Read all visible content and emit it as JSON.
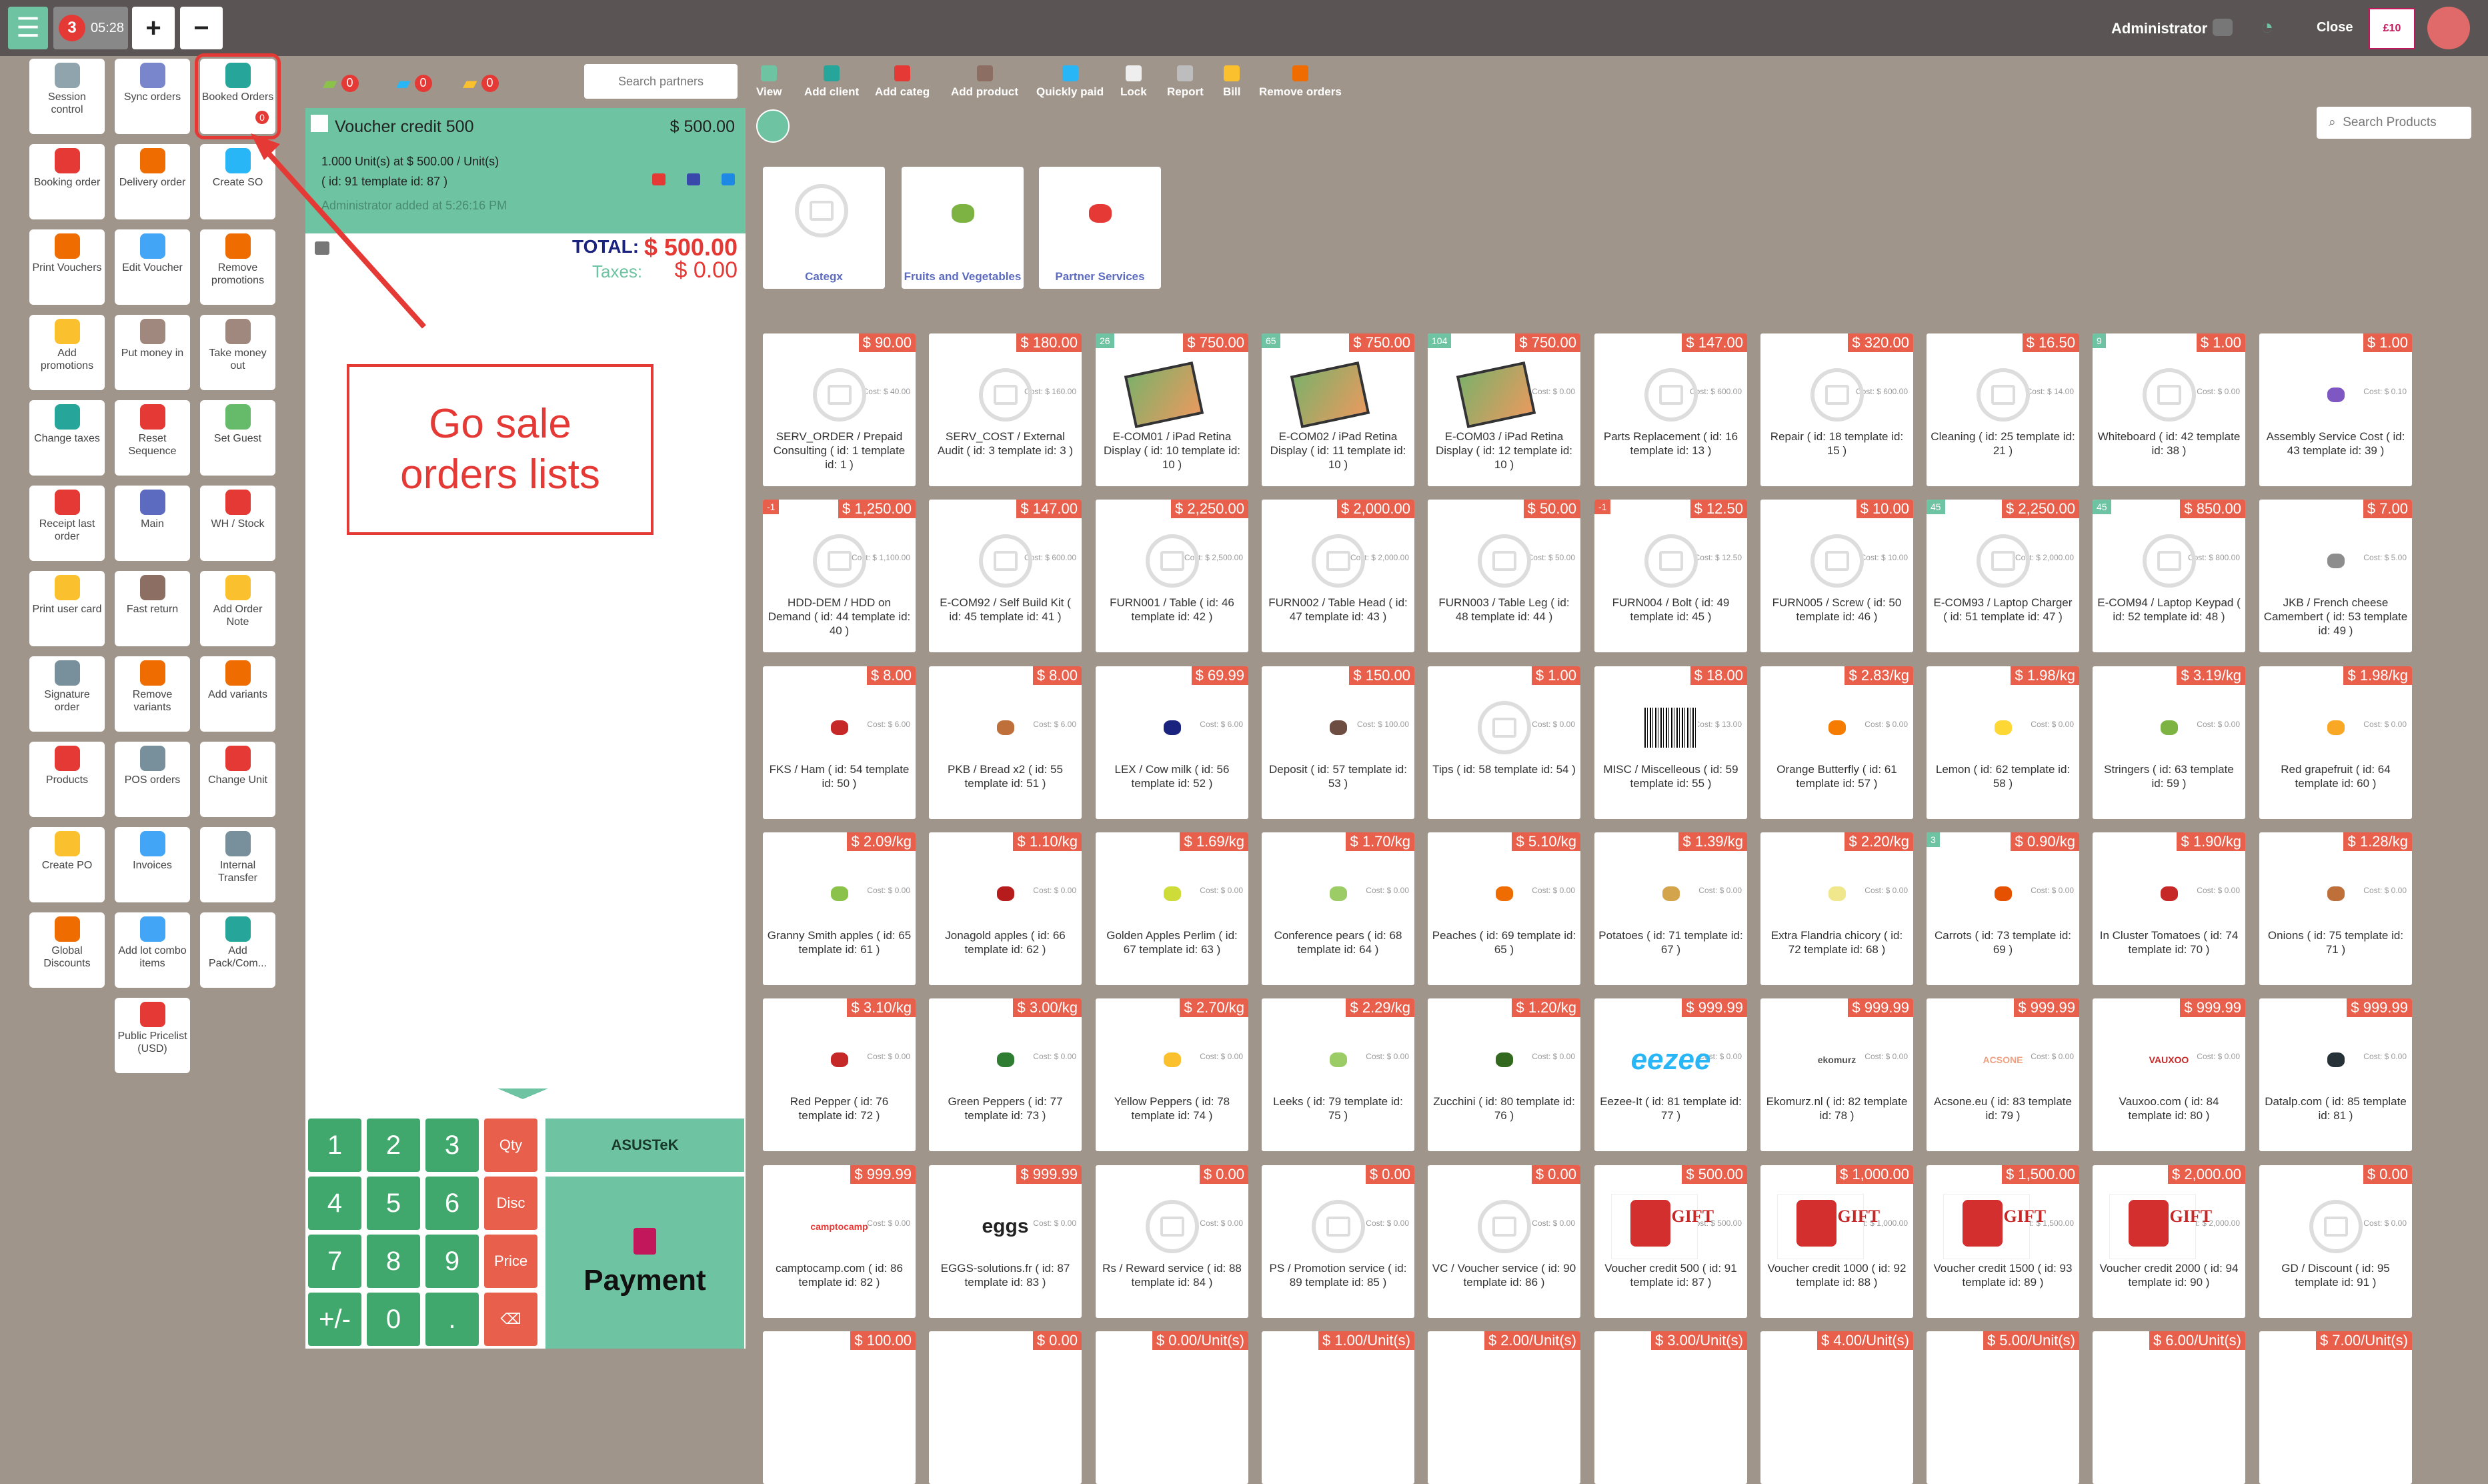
{
  "topbar": {
    "orders_count": "3",
    "time": "05:28",
    "plus": "+",
    "minus": "−",
    "user": "Administrator",
    "close": "Close",
    "gift_label": "£10"
  },
  "actions": [
    {
      "label": "Session control",
      "icon": "session-icon",
      "color": "#90a4ae"
    },
    {
      "label": "Sync orders",
      "icon": "sync-icon",
      "color": "#7986cb"
    },
    {
      "label": "Booked Orders",
      "icon": "booked-orders-icon",
      "color": "#26a69a",
      "badge": "0"
    },
    {
      "label": "Booking order",
      "icon": "booking-icon",
      "color": "#e53935"
    },
    {
      "label": "Delivery order",
      "icon": "delivery-icon",
      "color": "#ef6c00"
    },
    {
      "label": "Create SO",
      "icon": "create-so-icon",
      "color": "#29b6f6"
    },
    {
      "label": "Print Vouchers",
      "icon": "print-voucher-icon",
      "color": "#ef6c00"
    },
    {
      "label": "Edit Voucher",
      "icon": "edit-voucher-icon",
      "color": "#42a5f5"
    },
    {
      "label": "Remove promotions",
      "icon": "remove-promo-icon",
      "color": "#ef6c00"
    },
    {
      "label": "Add promotions",
      "icon": "add-promo-icon",
      "color": "#fbc02d"
    },
    {
      "label": "Put money in",
      "icon": "money-in-icon",
      "color": "#a1887f"
    },
    {
      "label": "Take money out",
      "icon": "money-out-icon",
      "color": "#a1887f"
    },
    {
      "label": "Change taxes",
      "icon": "taxes-icon",
      "color": "#26a69a"
    },
    {
      "label": "Reset Sequence",
      "icon": "reset-icon",
      "color": "#e53935"
    },
    {
      "label": "Set Guest",
      "icon": "guest-icon",
      "color": "#66bb6a"
    },
    {
      "label": "Receipt last order",
      "icon": "receipt-icon",
      "color": "#e53935"
    },
    {
      "label": "Main",
      "icon": "main-icon",
      "color": "#5c6bc0"
    },
    {
      "label": "WH / Stock",
      "icon": "stock-icon",
      "color": "#e53935"
    },
    {
      "label": "Print user card",
      "icon": "user-card-icon",
      "color": "#fbc02d"
    },
    {
      "label": "Fast return",
      "icon": "fast-return-icon",
      "color": "#8d6e63"
    },
    {
      "label": "Add Order Note",
      "icon": "note-icon",
      "color": "#fbc02d"
    },
    {
      "label": "Signature order",
      "icon": "signature-icon",
      "color": "#78909c"
    },
    {
      "label": "Remove variants",
      "icon": "remove-variants-icon",
      "color": "#ef6c00"
    },
    {
      "label": "Add variants",
      "icon": "add-variants-icon",
      "color": "#ef6c00"
    },
    {
      "label": "Products",
      "icon": "products-icon",
      "color": "#e53935"
    },
    {
      "label": "POS orders",
      "icon": "pos-orders-icon",
      "color": "#78909c"
    },
    {
      "label": "Change Unit",
      "icon": "change-unit-icon",
      "color": "#e53935"
    },
    {
      "label": "Create PO",
      "icon": "create-po-icon",
      "color": "#fbc02d"
    },
    {
      "label": "Invoices",
      "icon": "invoices-icon",
      "color": "#42a5f5"
    },
    {
      "label": "Internal Transfer",
      "icon": "transfer-icon",
      "color": "#78909c"
    },
    {
      "label": "Global Discounts",
      "icon": "discounts-icon",
      "color": "#ef6c00"
    },
    {
      "label": "Add lot combo items",
      "icon": "lot-icon",
      "color": "#42a5f5"
    },
    {
      "label": "Add Pack/Com...",
      "icon": "pack-icon",
      "color": "#26a69a"
    },
    {
      "label": "Public Pricelist (USD)",
      "icon": "pricelist-icon",
      "color": "#e53935"
    }
  ],
  "order": {
    "chips": [
      "0",
      "0",
      "0"
    ],
    "search_placeholder": "Search partners",
    "line_name": "Voucher credit 500",
    "line_price": "$ 500.00",
    "line_qty": "1.000 Unit(s) at $ 500.00 / Unit(s)",
    "line_id": "( id: 91 template id: 87 )",
    "line_added": "Administrator added at 5:26:16 PM",
    "total_label": "TOTAL:",
    "total_value": "$ 500.00",
    "taxes_label": "Taxes:",
    "taxes_value": "$ 0.00"
  },
  "keypad": [
    "1",
    "2",
    "3",
    "Qty",
    "4",
    "5",
    "6",
    "Disc",
    "7",
    "8",
    "9",
    "Price",
    "+/-",
    "0",
    ".",
    "⌫"
  ],
  "customer": "ASUSTeK",
  "payment": "Payment",
  "toolbar": [
    {
      "label": "View",
      "color": "#6ec3a2"
    },
    {
      "label": "Add client",
      "color": "#26a69a"
    },
    {
      "label": "Add categ",
      "color": "#e53935"
    },
    {
      "label": "Add product",
      "color": "#8d6e63"
    },
    {
      "label": "Quickly paid",
      "color": "#29b6f6"
    },
    {
      "label": "Lock",
      "color": "#eeeeee"
    },
    {
      "label": "Report",
      "color": "#bdbdbd"
    },
    {
      "label": "Bill",
      "color": "#fbc02d"
    },
    {
      "label": "Remove orders",
      "color": "#ef6c00"
    }
  ],
  "search_products": "Search Products",
  "categories": [
    "Categx",
    "Fruits and Vegetables",
    "Partner Services"
  ],
  "products": [
    {
      "price": "$ 90.00",
      "cost": "Cost: $ 40.00",
      "name": "SERV_ORDER / Prepaid Consulting ( id: 1 template id: 1 )",
      "img": "ph"
    },
    {
      "price": "$ 180.00",
      "cost": "Cost: $ 160.00",
      "name": "SERV_COST / External Audit ( id: 3 template id: 3 )",
      "img": "ph"
    },
    {
      "price": "$ 750.00",
      "stock": "26",
      "name": "E-COM01 / iPad Retina Display ( id: 10 template id: 10 )",
      "img": "ipad"
    },
    {
      "price": "$ 750.00",
      "stock": "65",
      "name": "E-COM02 / iPad Retina Display ( id: 11 template id: 10 )",
      "img": "ipad"
    },
    {
      "price": "$ 750.00",
      "stock": "104",
      "cost": "Cost: $ 0.00",
      "name": "E-COM03 / iPad Retina Display ( id: 12 template id: 10 )",
      "img": "ipad"
    },
    {
      "price": "$ 147.00",
      "cost": "Cost: $ 600.00",
      "name": "Parts Replacement ( id: 16 template id: 13 )",
      "img": "ph"
    },
    {
      "price": "$ 320.00",
      "cost": "Cost: $ 600.00",
      "name": "Repair ( id: 18 template id: 15 )",
      "img": "ph"
    },
    {
      "price": "$ 16.50",
      "cost": "Cost: $ 14.00",
      "name": "Cleaning ( id: 25 template id: 21 )",
      "img": "ph"
    },
    {
      "price": "$ 1.00",
      "stock": "9",
      "cost": "Cost: $ 0.00",
      "name": "Whiteboard ( id: 42 template id: 38 )",
      "img": "ph"
    },
    {
      "price": "$ 1.00",
      "cost": "Cost: $ 0.10",
      "name": "Assembly Service Cost ( id: 43 template id: 39 )",
      "img": "sw",
      "sw": "#7e57c2"
    },
    {
      "price": "$ 1,250.00",
      "stock": "-1",
      "neg": true,
      "cost": "Cost: $ 1,100.00",
      "name": "HDD-DEM / HDD on Demand ( id: 44 template id: 40 )",
      "img": "ph"
    },
    {
      "price": "$ 147.00",
      "cost": "Cost: $ 600.00",
      "name": "E-COM92 / Self Build Kit ( id: 45 template id: 41 )",
      "img": "ph"
    },
    {
      "price": "$ 2,250.00",
      "cost": "Cost: $ 2,500.00",
      "name": "FURN001 / Table ( id: 46 template id: 42 )",
      "img": "ph"
    },
    {
      "price": "$ 2,000.00",
      "cost": "Cost: $ 2,000.00",
      "name": "FURN002 / Table Head ( id: 47 template id: 43 )",
      "img": "ph"
    },
    {
      "price": "$ 50.00",
      "cost": "Cost: $ 50.00",
      "name": "FURN003 / Table Leg ( id: 48 template id: 44 )",
      "img": "ph"
    },
    {
      "price": "$ 12.50",
      "stock": "-1",
      "neg": true,
      "cost": "Cost: $ 12.50",
      "name": "FURN004 / Bolt ( id: 49 template id: 45 )",
      "img": "ph"
    },
    {
      "price": "$ 10.00",
      "cost": "Cost: $ 10.00",
      "name": "FURN005 / Screw ( id: 50 template id: 46 )",
      "img": "ph"
    },
    {
      "price": "$ 2,250.00",
      "stock": "45",
      "cost": "Cost: $ 2,000.00",
      "name": "E-COM93 / Laptop Charger ( id: 51 template id: 47 )",
      "img": "ph"
    },
    {
      "price": "$ 850.00",
      "stock": "45",
      "cost": "Cost: $ 800.00",
      "name": "E-COM94 / Laptop Keypad ( id: 52 template id: 48 )",
      "img": "ph"
    },
    {
      "price": "$ 7.00",
      "cost": "Cost: $ 5.00",
      "name": "JKB / French cheese Camembert ( id: 53 template id: 49 )",
      "img": "sw",
      "sw": "#8d8d8d"
    },
    {
      "price": "$ 8.00",
      "cost": "Cost: $ 6.00",
      "name": "FKS / Ham ( id: 54 template id: 50 )",
      "img": "sw",
      "sw": "#c62828"
    },
    {
      "price": "$ 8.00",
      "cost": "Cost: $ 6.00",
      "name": "PKB / Bread x2 ( id: 55 template id: 51 )",
      "img": "sw",
      "sw": "#bf6f3a"
    },
    {
      "price": "$ 69.99",
      "cost": "Cost: $ 6.00",
      "name": "LEX / Cow milk ( id: 56 template id: 52 )",
      "img": "sw",
      "sw": "#1a237e"
    },
    {
      "price": "$ 150.00",
      "cost": "Cost: $ 100.00",
      "name": "Deposit ( id: 57 template id: 53 )",
      "img": "sw",
      "sw": "#6d4c41"
    },
    {
      "price": "$ 1.00",
      "cost": "Cost: $ 0.00",
      "name": "Tips ( id: 58 template id: 54 )",
      "img": "ph"
    },
    {
      "price": "$ 18.00",
      "cost": "Cost: $ 13.00",
      "name": "MISC / Miscelleous ( id: 59 template id: 55 )",
      "img": "barcode"
    },
    {
      "price": "$ 2.83/kg",
      "cost": "Cost: $ 0.00",
      "name": "Orange Butterfly ( id: 61 template id: 57 )",
      "img": "sw",
      "sw": "#f57c00"
    },
    {
      "price": "$ 1.98/kg",
      "cost": "Cost: $ 0.00",
      "name": "Lemon ( id: 62 template id: 58 )",
      "img": "sw",
      "sw": "#fdd835"
    },
    {
      "price": "$ 3.19/kg",
      "cost": "Cost: $ 0.00",
      "name": "Stringers ( id: 63 template id: 59 )",
      "img": "sw",
      "sw": "#7cb342"
    },
    {
      "price": "$ 1.98/kg",
      "cost": "Cost: $ 0.00",
      "name": "Red grapefruit ( id: 64 template id: 60 )",
      "img": "sw",
      "sw": "#f9a825"
    },
    {
      "price": "$ 2.09/kg",
      "cost": "Cost: $ 0.00",
      "name": "Granny Smith apples ( id: 65 template id: 61 )",
      "img": "sw",
      "sw": "#8bc34a"
    },
    {
      "price": "$ 1.10/kg",
      "cost": "Cost: $ 0.00",
      "name": "Jonagold apples ( id: 66 template id: 62 )",
      "img": "sw",
      "sw": "#b71c1c"
    },
    {
      "price": "$ 1.69/kg",
      "cost": "Cost: $ 0.00",
      "name": "Golden Apples Perlim ( id: 67 template id: 63 )",
      "img": "sw",
      "sw": "#cddc39"
    },
    {
      "price": "$ 1.70/kg",
      "cost": "Cost: $ 0.00",
      "name": "Conference pears ( id: 68 template id: 64 )",
      "img": "sw",
      "sw": "#9ccc65"
    },
    {
      "price": "$ 5.10/kg",
      "cost": "Cost: $ 0.00",
      "name": "Peaches ( id: 69 template id: 65 )",
      "img": "sw",
      "sw": "#ef6c00"
    },
    {
      "price": "$ 1.39/kg",
      "cost": "Cost: $ 0.00",
      "name": "Potatoes ( id: 71 template id: 67 )",
      "img": "sw",
      "sw": "#d4a44c"
    },
    {
      "price": "$ 2.20/kg",
      "cost": "Cost: $ 0.00",
      "name": "Extra Flandria chicory ( id: 72 template id: 68 )",
      "img": "sw",
      "sw": "#f0e68c"
    },
    {
      "price": "$ 0.90/kg",
      "stock": "3",
      "cost": "Cost: $ 0.00",
      "name": "Carrots ( id: 73 template id: 69 )",
      "img": "sw",
      "sw": "#e65100"
    },
    {
      "price": "$ 1.90/kg",
      "cost": "Cost: $ 0.00",
      "name": "In Cluster Tomatoes ( id: 74 template id: 70 )",
      "img": "sw",
      "sw": "#c62828"
    },
    {
      "price": "$ 1.28/kg",
      "cost": "Cost: $ 0.00",
      "name": "Onions ( id: 75 template id: 71 )",
      "img": "sw",
      "sw": "#bf6f3a"
    },
    {
      "price": "$ 3.10/kg",
      "cost": "Cost: $ 0.00",
      "name": "Red Pepper ( id: 76 template id: 72 )",
      "img": "sw",
      "sw": "#c62828"
    },
    {
      "price": "$ 3.00/kg",
      "cost": "Cost: $ 0.00",
      "name": "Green Peppers ( id: 77 template id: 73 )",
      "img": "sw",
      "sw": "#2e7d32"
    },
    {
      "price": "$ 2.70/kg",
      "cost": "Cost: $ 0.00",
      "name": "Yellow Peppers ( id: 78 template id: 74 )",
      "img": "sw",
      "sw": "#fbc02d"
    },
    {
      "price": "$ 2.29/kg",
      "cost": "Cost: $ 0.00",
      "name": "Leeks ( id: 79 template id: 75 )",
      "img": "sw",
      "sw": "#9ccc65"
    },
    {
      "price": "$ 1.20/kg",
      "cost": "Cost: $ 0.00",
      "name": "Zucchini ( id: 80 template id: 76 )",
      "img": "sw",
      "sw": "#33691e"
    },
    {
      "price": "$ 999.99",
      "cost": "Cost: $ 0.00",
      "name": "Eezee-It ( id: 81 template id: 77 )",
      "img": "logo",
      "logo": "eezee",
      "logocolor": "#29b6f6"
    },
    {
      "price": "$ 999.99",
      "cost": "Cost: $ 0.00",
      "name": "Ekomurz.nl ( id: 82 template id: 78 )",
      "img": "logo",
      "logo": "ekomurz",
      "logocolor": "#555"
    },
    {
      "price": "$ 999.99",
      "cost": "Cost: $ 0.00",
      "name": "Acsone.eu ( id: 83 template id: 79 )",
      "img": "logo",
      "logo": "ACSONE",
      "logocolor": "#f0a080"
    },
    {
      "price": "$ 999.99",
      "cost": "Cost: $ 0.00",
      "name": "Vauxoo.com ( id: 84 template id: 80 )",
      "img": "logo",
      "logo": "VAUXOO",
      "logocolor": "#c62828"
    },
    {
      "price": "$ 999.99",
      "cost": "Cost: $ 0.00",
      "name": "Datalp.com ( id: 85 template id: 81 )",
      "img": "sw",
      "sw": "#263238"
    },
    {
      "price": "$ 999.99",
      "cost": "Cost: $ 0.00",
      "name": "camptocamp.com ( id: 86 template id: 82 )",
      "img": "logo",
      "logo": "camptocamp",
      "logocolor": "#e53935"
    },
    {
      "price": "$ 999.99",
      "cost": "Cost: $ 0.00",
      "name": "EGGS-solutions.fr ( id: 87 template id: 83 )",
      "img": "logo",
      "logo": "eggs",
      "logocolor": "#222"
    },
    {
      "price": "$ 0.00",
      "cost": "Cost: $ 0.00",
      "name": "Rs / Reward service ( id: 88 template id: 84 )",
      "img": "ph"
    },
    {
      "price": "$ 0.00",
      "cost": "Cost: $ 0.00",
      "name": "PS / Promotion service ( id: 89 template id: 85 )",
      "img": "ph"
    },
    {
      "price": "$ 0.00",
      "cost": "Cost: $ 0.00",
      "name": "VC / Voucher service ( id: 90 template id: 86 )",
      "img": "ph"
    },
    {
      "price": "$ 500.00",
      "cost": "Cost: $ 500.00",
      "name": "Voucher credit 500 ( id: 91 template id: 87 )",
      "img": "gift"
    },
    {
      "price": "$ 1,000.00",
      "cost": "Cost: $ 1,000.00",
      "name": "Voucher credit 1000 ( id: 92 template id: 88 )",
      "img": "gift"
    },
    {
      "price": "$ 1,500.00",
      "cost": "Cost: $ 1,500.00",
      "name": "Voucher credit 1500 ( id: 93 template id: 89 )",
      "img": "gift"
    },
    {
      "price": "$ 2,000.00",
      "cost": "Cost: $ 2,000.00",
      "name": "Voucher credit 2000 ( id: 94 template id: 90 )",
      "img": "gift"
    },
    {
      "price": "$ 0.00",
      "cost": "Cost: $ 0.00",
      "name": "GD / Discount ( id: 95 template id: 91 )",
      "img": "ph"
    },
    {
      "price": "$ 100.00",
      "name": "",
      "img": "none"
    },
    {
      "price": "$ 0.00",
      "name": "",
      "img": "none"
    },
    {
      "price": "$ 0.00/Unit(s)",
      "name": "",
      "img": "none"
    },
    {
      "price": "$ 1.00/Unit(s)",
      "name": "",
      "img": "none"
    },
    {
      "price": "$ 2.00/Unit(s)",
      "name": "",
      "img": "none"
    },
    {
      "price": "$ 3.00/Unit(s)",
      "name": "",
      "img": "none"
    },
    {
      "price": "$ 4.00/Unit(s)",
      "name": "",
      "img": "none"
    },
    {
      "price": "$ 5.00/Unit(s)",
      "name": "",
      "img": "none"
    },
    {
      "price": "$ 6.00/Unit(s)",
      "name": "",
      "img": "none"
    },
    {
      "price": "$ 7.00/Unit(s)",
      "name": "",
      "img": "none"
    }
  ],
  "gift_word": "GIFT",
  "annotation": {
    "line1": "Go sale",
    "line2": "orders lists"
  }
}
